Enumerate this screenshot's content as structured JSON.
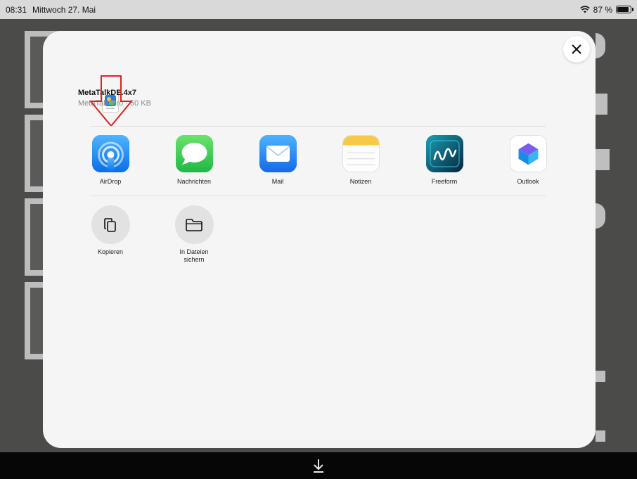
{
  "status_bar": {
    "time": "08:31",
    "date": "Mittwoch 27. Mai",
    "battery_percent": "87 %",
    "battery_level": 0.87
  },
  "share_sheet": {
    "file": {
      "name": "MetaTalkDE.4x7",
      "meta": "MetaTalk Pro · 50 KB"
    },
    "apps": [
      {
        "label": "AirDrop",
        "icon": "airdrop-icon"
      },
      {
        "label": "Nachrichten",
        "icon": "messages-icon"
      },
      {
        "label": "Mail",
        "icon": "mail-icon"
      },
      {
        "label": "Notizen",
        "icon": "notes-icon"
      },
      {
        "label": "Freeform",
        "icon": "freeform-icon"
      },
      {
        "label": "Outlook",
        "icon": "outlook-icon"
      }
    ],
    "actions": [
      {
        "label": "Kopieren",
        "icon": "copy-icon"
      },
      {
        "label": "In Dateien sichern",
        "icon": "folder-icon"
      }
    ]
  },
  "colors": {
    "annotation_arrow": "#e02020",
    "airdrop": "#1f8cf2",
    "messages": "#34c759",
    "mail": "#1a7cf5",
    "notes": "#f7c948",
    "freeform": "#0c3d5c",
    "outlook": "#0f6cbd"
  }
}
